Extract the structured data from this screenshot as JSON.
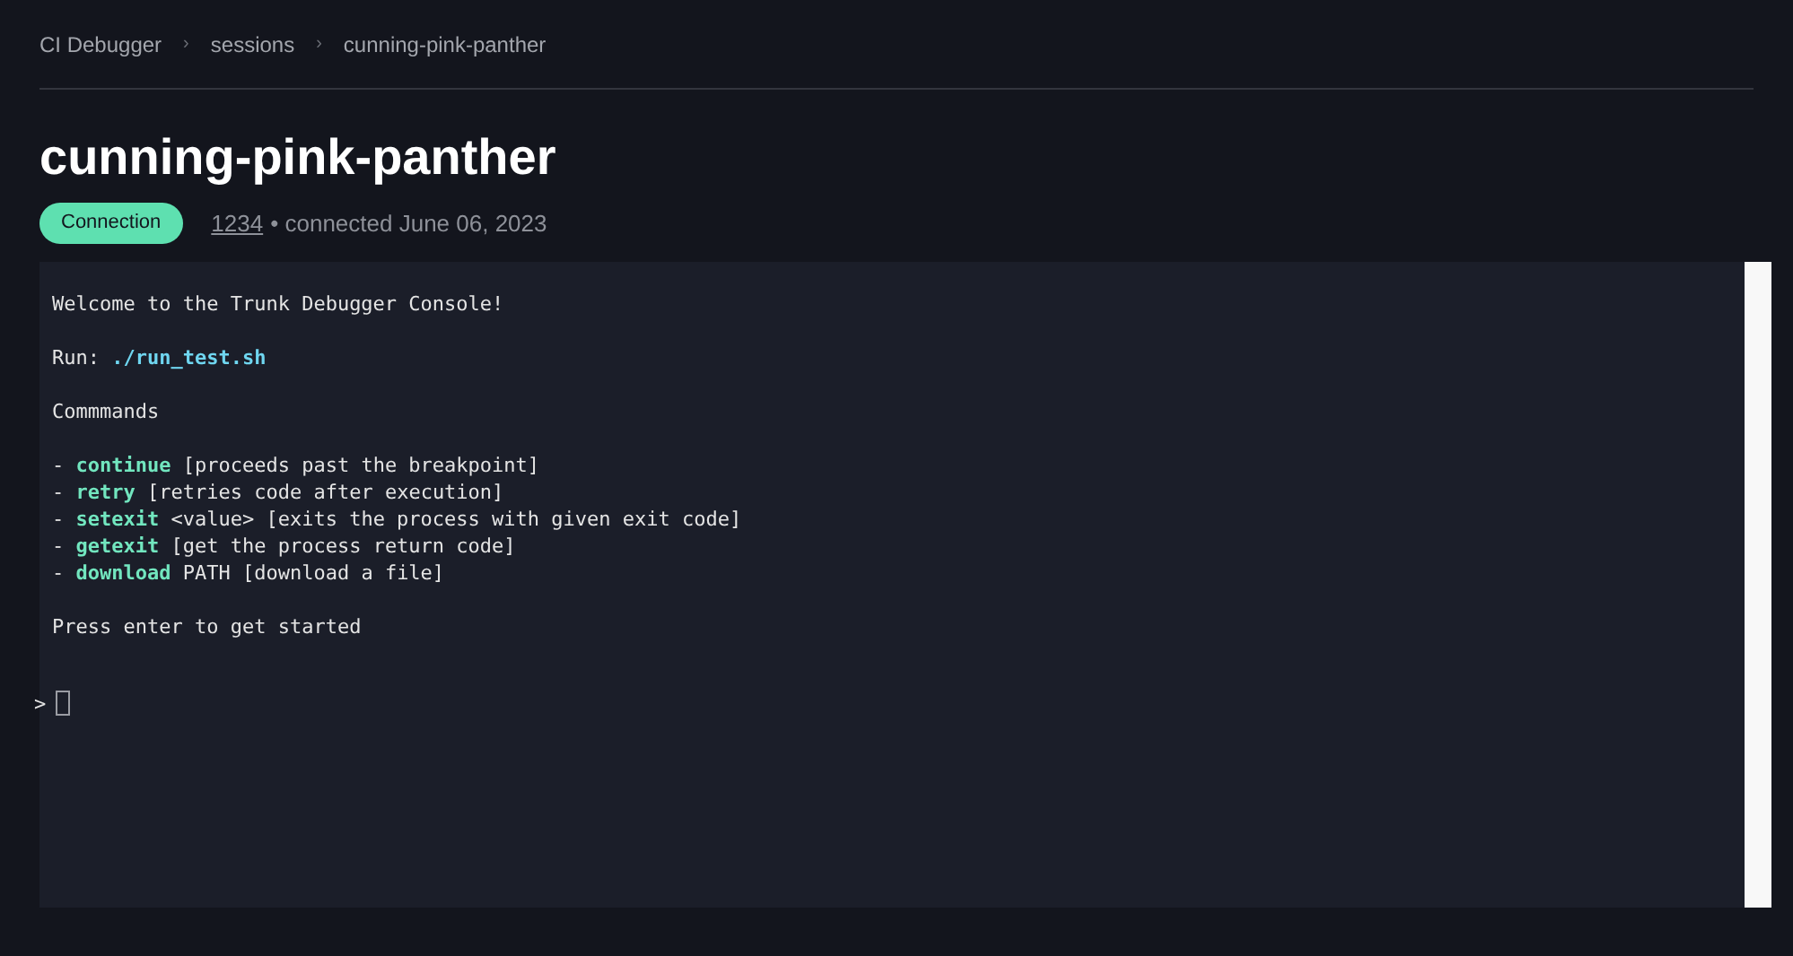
{
  "breadcrumb": [
    {
      "label": "CI Debugger",
      "separator": "›"
    },
    {
      "label": "sessions",
      "separator": "›"
    },
    {
      "label": "cunning-pink-panther"
    }
  ],
  "title": "cunning-pink-panther",
  "badge": "Connection",
  "session_link": "1234",
  "meta": "• connected June 06, 2023",
  "terminal": {
    "blocks": [
      [
        [
          {
            "kind": "plain",
            "text": "Welcome to the Trunk Debugger Console!"
          }
        ]
      ],
      [
        [
          {
            "kind": "plain",
            "text": "Run: "
          },
          {
            "kind": "link",
            "text": "./run_test.sh"
          }
        ]
      ],
      [
        [
          {
            "kind": "plain",
            "text": "Commmands"
          }
        ]
      ],
      [
        [
          {
            "kind": "plain",
            "text": "- "
          },
          {
            "kind": "command",
            "text": "continue"
          },
          {
            "kind": "plain",
            "text": " [proceeds past the breakpoint]"
          }
        ],
        [
          {
            "kind": "plain",
            "text": "- "
          },
          {
            "kind": "command",
            "text": "retry"
          },
          {
            "kind": "plain",
            "text": " [retries code after execution]"
          }
        ],
        [
          {
            "kind": "plain",
            "text": "- "
          },
          {
            "kind": "command",
            "text": "setexit"
          },
          {
            "kind": "plain",
            "text": " <value> [exits the process with given exit code]"
          }
        ],
        [
          {
            "kind": "plain",
            "text": "- "
          },
          {
            "kind": "command",
            "text": "getexit"
          },
          {
            "kind": "plain",
            "text": " [get the process return code]"
          }
        ],
        [
          {
            "kind": "plain",
            "text": "- "
          },
          {
            "kind": "command",
            "text": "download"
          },
          {
            "kind": "plain",
            "text": " PATH [download a file]"
          }
        ]
      ],
      [
        [
          {
            "kind": "plain",
            "text": "Press enter to get started"
          }
        ]
      ]
    ],
    "prompt": ">"
  }
}
